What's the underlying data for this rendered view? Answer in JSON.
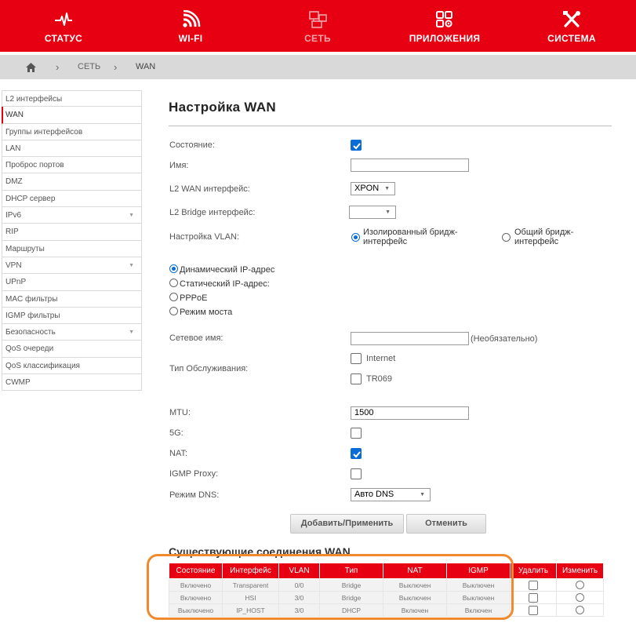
{
  "nav": [
    {
      "label": "СТАТУС",
      "icon": "pulse-icon",
      "active": false
    },
    {
      "label": "WI-FI",
      "icon": "wifi-icon",
      "active": false
    },
    {
      "label": "СЕТЬ",
      "icon": "network-icon",
      "active": true
    },
    {
      "label": "ПРИЛОЖЕНИЯ",
      "icon": "apps-icon",
      "active": false
    },
    {
      "label": "СИСТЕМА",
      "icon": "tools-icon",
      "active": false
    }
  ],
  "breadcrumb": {
    "section": "СЕТЬ",
    "page": "WAN"
  },
  "sidebar": [
    {
      "label": "L2 интерфейсы"
    },
    {
      "label": "WAN",
      "active": true
    },
    {
      "label": "Группы интерфейсов"
    },
    {
      "label": "LAN"
    },
    {
      "label": "Проброс портов"
    },
    {
      "label": "DMZ"
    },
    {
      "label": "DHCP сервер"
    },
    {
      "label": "IPv6",
      "caret": true
    },
    {
      "label": "RIP"
    },
    {
      "label": "Маршруты"
    },
    {
      "label": "VPN",
      "caret": true
    },
    {
      "label": "UPnP"
    },
    {
      "label": "MAC фильтры"
    },
    {
      "label": "IGMP фильтры"
    },
    {
      "label": "Безопасность",
      "caret": true
    },
    {
      "label": "QoS очереди"
    },
    {
      "label": "QoS классификация"
    },
    {
      "label": "CWMP"
    }
  ],
  "form": {
    "title": "Настройка WAN",
    "state_label": "Состояние:",
    "state_checked": true,
    "name_label": "Имя:",
    "name_value": "",
    "l2wan_label": "L2 WAN интерфейс:",
    "l2wan_value": "XPON",
    "l2bridge_label": "L2 Bridge интерфейс:",
    "l2bridge_value": "",
    "vlan_label": "Настройка VLAN:",
    "vlan_opt1_line1": "Изолированный бридж-",
    "vlan_opt1_line2": "интерфейс",
    "vlan_opt2_line1": "Общий бридж-",
    "vlan_opt2_line2": "интерфейс",
    "vlan_selected": "isolated",
    "modes": [
      "Динамический IP-адрес",
      "Статический IP-адрес:",
      "PPPoE",
      "Режим моста"
    ],
    "mode_selected": 0,
    "netname_label": "Сетевое имя:",
    "netname_value": "",
    "optional_note": "(Необязательно)",
    "service_label": "Тип Обслуживания:",
    "service_opts": [
      {
        "label": "Internet",
        "checked": false
      },
      {
        "label": "TR069",
        "checked": false
      }
    ],
    "mtu_label": "MTU:",
    "mtu_value": "1500",
    "g5_label": "5G:",
    "g5_checked": false,
    "nat_label": "NAT:",
    "nat_checked": true,
    "igmp_label": "IGMP Proxy:",
    "igmp_checked": false,
    "dns_label": "Режим DNS:",
    "dns_value": "Авто DNS",
    "apply_button": "Добавить/Применить",
    "cancel_button": "Отменить"
  },
  "connections": {
    "title": "Существующие соединения WAN",
    "headers": [
      "Состояние",
      "Интерфейс",
      "VLAN",
      "Тип",
      "NAT",
      "IGMP",
      "Удалить",
      "Изменить"
    ],
    "rows": [
      [
        "Включено",
        "Transparent",
        "0/0",
        "Bridge",
        "Выключен",
        "Выключен"
      ],
      [
        "Включено",
        "HSI",
        "3/0",
        "Bridge",
        "Выключен",
        "Выключен"
      ],
      [
        "Выключено",
        "IP_HOST",
        "3/0",
        "DHCP",
        "Включен",
        "Включен"
      ]
    ]
  },
  "colors": {
    "brand": "#e60012",
    "accent": "#0a6cd6",
    "highlight": "#f08a2c"
  }
}
